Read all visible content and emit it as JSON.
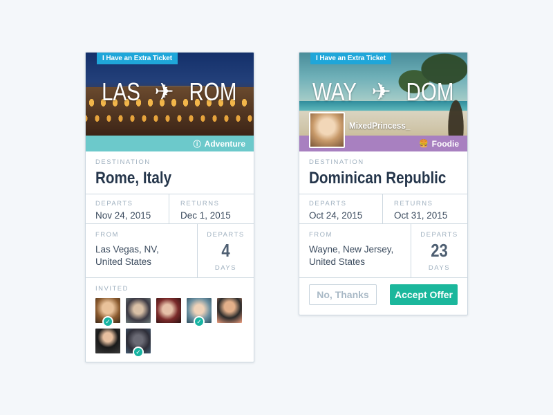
{
  "cards": [
    {
      "tag": "I Have an Extra Ticket",
      "from_code": "LAS",
      "to_code": "ROM",
      "category": "Adventure",
      "destination_label": "DESTINATION",
      "destination": "Rome, Italy",
      "departs_label": "DEPARTS",
      "departs": "Nov 24, 2015",
      "returns_label": "RETURNS",
      "returns": "Dec 1, 2015",
      "from_label": "FROM",
      "from_line1": "Las Vegas, NV,",
      "from_line2": "United States",
      "countdown_label": "DEPARTS",
      "countdown": "4",
      "countdown_unit": "DAYS",
      "invited_label": "INVITED"
    },
    {
      "tag": "I Have an Extra Ticket",
      "from_code": "WAY",
      "to_code": "DOM",
      "host": "MixedPrincess_",
      "category": "Foodie",
      "destination_label": "DESTINATION",
      "destination": "Dominican Republic",
      "departs_label": "DEPARTS",
      "departs": "Oct 24, 2015",
      "returns_label": "RETURNS",
      "returns": "Oct 31, 2015",
      "from_label": "FROM",
      "from_line1": "Wayne, New Jersey,",
      "from_line2": "United States",
      "countdown_label": "DEPARTS",
      "countdown": "23",
      "countdown_unit": "DAYS",
      "decline": "No, Thanks",
      "accept": "Accept Offer"
    }
  ],
  "colors": {
    "tag": "#1fa6d9",
    "adventure": "#6cc9cb",
    "foodie": "#a880c0",
    "accept": "#1bb79c"
  },
  "icons": {
    "plane": "airplane-icon",
    "adventure": "compass-icon",
    "foodie": "burger-icon",
    "confirmed": "checkmark-icon"
  }
}
